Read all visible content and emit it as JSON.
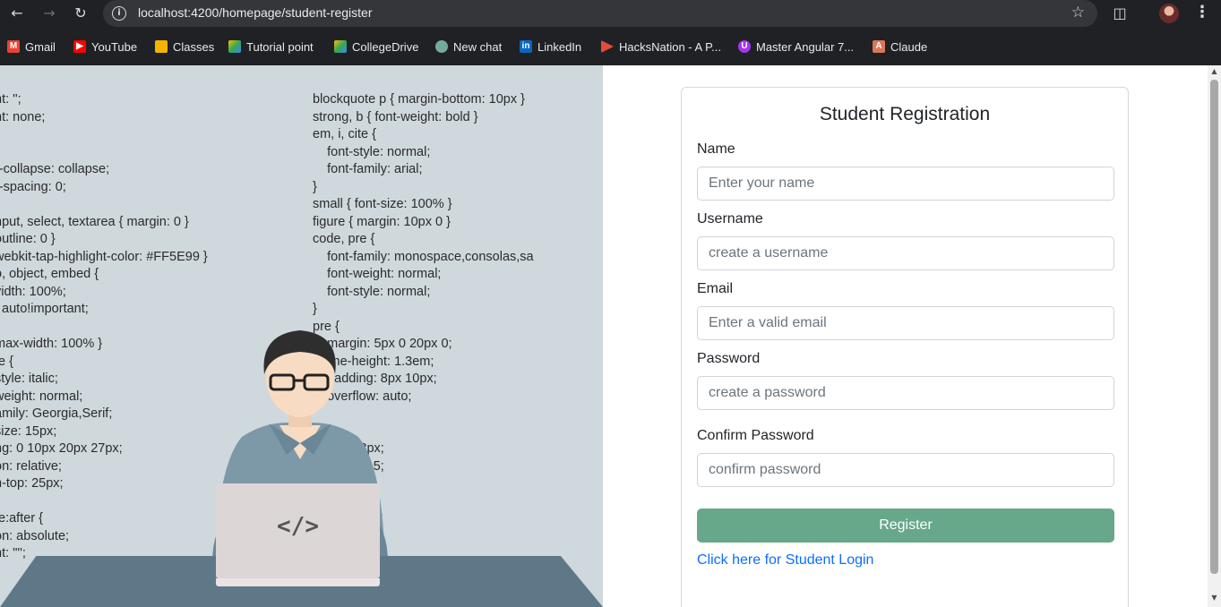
{
  "browser": {
    "url": "localhost:4200/homepage/student-register",
    "bookmarks": [
      {
        "label": "Gmail",
        "icon": "gmail-icon",
        "color": "#ea4335"
      },
      {
        "label": "YouTube",
        "icon": "youtube-icon",
        "color": "#ff0000"
      },
      {
        "label": "Classes",
        "icon": "classroom-icon",
        "color": "#f4b400"
      },
      {
        "label": "Tutorial point",
        "icon": "drive-icon",
        "color": "#34a853"
      },
      {
        "label": "CollegeDrive",
        "icon": "drive-icon",
        "color": "#34a853"
      },
      {
        "label": "New chat",
        "icon": "chatgpt-icon",
        "color": "#74aa9c"
      },
      {
        "label": "LinkedIn",
        "icon": "linkedin-icon",
        "color": "#0a66c2"
      },
      {
        "label": "HacksNation - A P...",
        "icon": "hacksnation-icon",
        "color": "#e34b3b"
      },
      {
        "label": "Master Angular 7...",
        "icon": "udemy-icon",
        "color": "#a435f0"
      },
      {
        "label": "Claude",
        "icon": "claude-icon",
        "color": "#d97757"
      }
    ]
  },
  "hero": {
    "code_left": "nt: '';\nnt: none;\n\n\nr-collapse: collapse;\nr-spacing: 0;\n\nnput, select, textarea { margin: 0 }\noutline: 0 }\nwebkit-tap-highlight-color: #FF5E99 }\no, object, embed {\nvidth: 100%;\n: auto!important;\n\nmax-width: 100% }\nte {\nstyle: italic;\nweight: normal;\namily: Georgia,Serif;\nsize: 15px;\nng: 0 10px 20px 27px;\non: relative;\nn-top: 25px;\n\nte:after {\non: absolute;\nnt: '\"';",
    "code_right": "blockquote p { margin-bottom: 10px }\nstrong, b { font-weight: bold }\nem, i, cite {\n    font-style: normal;\n    font-family: arial;\n}\nsmall { font-size: 100% }\nfigure { margin: 10px 0 }\ncode, pre {\n    font-family: monospace,consolas,sa\n    font-weight: normal;\n    font-style: normal;\n}\npre {\n    margin: 5px 0 20px 0;\n    line-height: 1.3em;\n    padding: 8px 10px;\n    overflow: auto;\n\n    {\n    ng: 0 8px;\n    eight: 1.5;\n\n\n    : 1px 6px;\n    0 2px;\n    lack;",
    "laptop_glyph": "</>"
  },
  "form": {
    "title": "Student Registration",
    "name_label": "Name",
    "name_placeholder": "Enter your name",
    "username_label": "Username",
    "username_placeholder": "create a username",
    "email_label": "Email",
    "email_placeholder": "Enter a valid email",
    "password_label": "Password",
    "password_placeholder": "create a password",
    "confirm_label": "Confirm Password",
    "confirm_placeholder": "confirm password",
    "register_label": "Register",
    "login_link": "Click here for Student Login",
    "accent": "#68a88a",
    "link_color": "#0d6efd"
  }
}
